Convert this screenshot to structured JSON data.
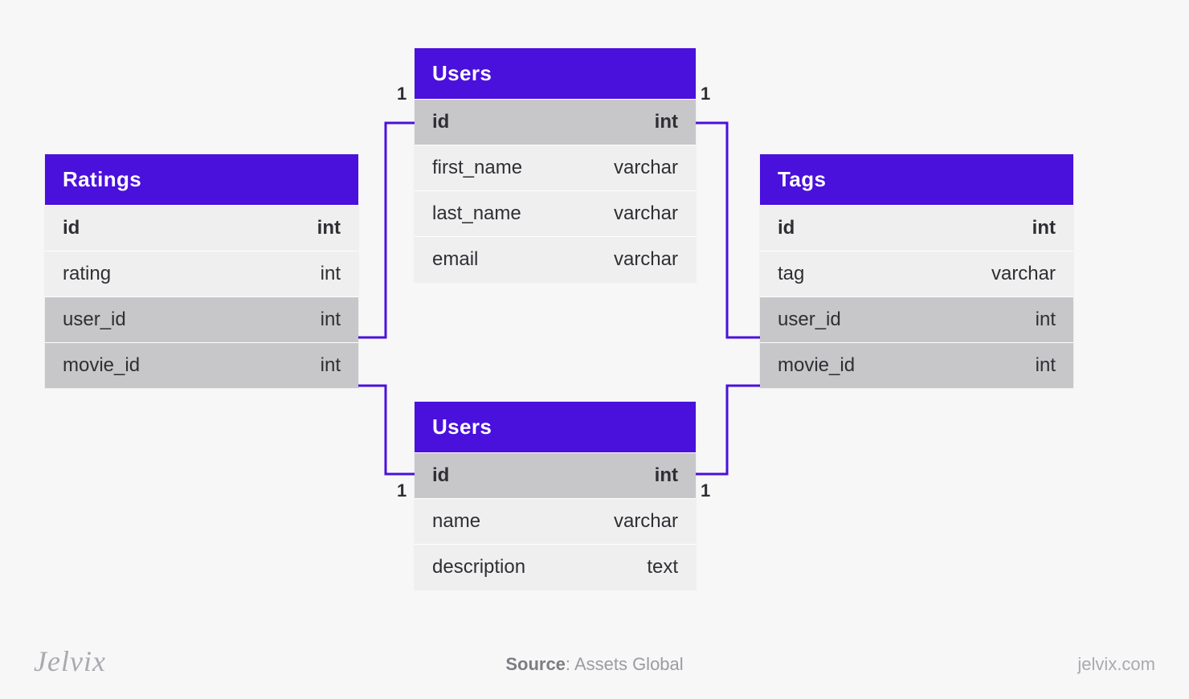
{
  "colors": {
    "accent": "#4a10dc",
    "pk_bg": "#c7c6c8",
    "row_bg": "#efeff0"
  },
  "entities": {
    "ratings": {
      "title": "Ratings",
      "rows": [
        {
          "name": "id",
          "type": "int",
          "kind": "pk"
        },
        {
          "name": "rating",
          "type": "int",
          "kind": "attr"
        },
        {
          "name": "user_id",
          "type": "int",
          "kind": "fk"
        },
        {
          "name": "movie_id",
          "type": "int",
          "kind": "fk"
        }
      ]
    },
    "users_top": {
      "title": "Users",
      "rows": [
        {
          "name": "id",
          "type": "int",
          "kind": "pk"
        },
        {
          "name": "first_name",
          "type": "varchar",
          "kind": "attr"
        },
        {
          "name": "last_name",
          "type": "varchar",
          "kind": "attr"
        },
        {
          "name": "email",
          "type": "varchar",
          "kind": "attr"
        }
      ]
    },
    "users_bottom": {
      "title": "Users",
      "rows": [
        {
          "name": "id",
          "type": "int",
          "kind": "pk"
        },
        {
          "name": "name",
          "type": "varchar",
          "kind": "attr"
        },
        {
          "name": "description",
          "type": "text",
          "kind": "attr"
        }
      ]
    },
    "tags": {
      "title": "Tags",
      "rows": [
        {
          "name": "id",
          "type": "int",
          "kind": "pk"
        },
        {
          "name": "tag",
          "type": "varchar",
          "kind": "attr"
        },
        {
          "name": "user_id",
          "type": "int",
          "kind": "fk"
        },
        {
          "name": "movie_id",
          "type": "int",
          "kind": "fk"
        }
      ]
    }
  },
  "cardinality_labels": {
    "l1": "1",
    "l2": "1",
    "l3": "1",
    "l4": "1"
  },
  "footer": {
    "logo": "Jelvix",
    "source_label": "Source",
    "source_value": "Assets Global",
    "site": "jelvix.com"
  }
}
